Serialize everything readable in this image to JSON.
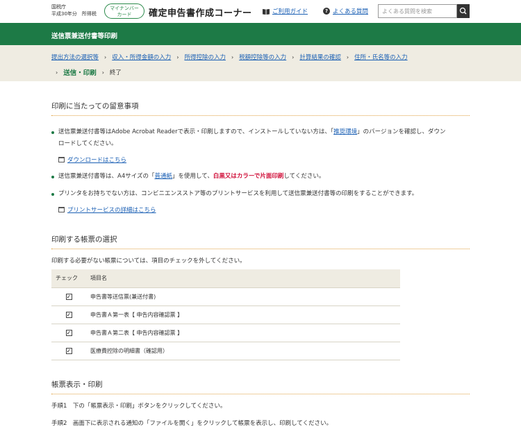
{
  "header": {
    "agency_line1": "国税庁",
    "agency_line2": "平成30年分　所得税",
    "mynumber_line1": "マイナンバー",
    "mynumber_line2": "カード",
    "title": "確定申告書作成コーナー",
    "guide_link": "ご利用ガイド",
    "faq_link": "よくある質問",
    "search_placeholder": "よくある質問を検索"
  },
  "page_heading": "送信票兼送付書等印刷",
  "breadcrumb": {
    "steps": [
      "提出方法の選択等",
      "収入・所得金額の入力",
      "所得控除の入力",
      "税額控除等の入力",
      "計算結果の確認",
      "住所・氏名等の入力"
    ],
    "current": "送信・印刷",
    "last": "終了"
  },
  "notes_section": {
    "heading": "印刷に当たっての留意事項",
    "b1_a": "送信票兼送付書等はAdobe Acrobat Readerで表示・印刷しますので、インストールしていない方は、「",
    "b1_link": "推奨環境",
    "b1_b": "」のバージョンを確認し、ダウン",
    "b1_c": "ロードしてください。",
    "download_link": "ダウンロードはこちら",
    "b2_a": "送信票兼送付書等は、A4サイズの「",
    "b2_link": "普通紙",
    "b2_b": "」を使用して、",
    "b2_red": "白黒又はカラーで片面印刷",
    "b2_c": "してください。",
    "b3": "プリンタをお持ちでない方は、コンビニエンスストア等のプリントサービスを利用して送信票兼送付書等の印刷をすることができます。",
    "print_service_link": "プリントサービスの詳細はこちら"
  },
  "forms_section": {
    "heading": "印刷する帳票の選択",
    "note": "印刷する必要がない帳票については、項目のチェックを外してください。",
    "col_check": "チェック",
    "col_item": "項目名",
    "rows": [
      {
        "name": "申告書等送信票(兼送付書)",
        "checked": "✓"
      },
      {
        "name": "申告書Ａ第一表【 申告内容確認票 】",
        "checked": "✓"
      },
      {
        "name": "申告書Ａ第二表【 申告内容確認票 】",
        "checked": "✓"
      },
      {
        "name": "医療費控除の明細書（確認用）",
        "checked": "✓"
      }
    ]
  },
  "print_section": {
    "heading": "帳票表示・印刷",
    "step1": "手順1　下の「帳票表示・印刷」ボタンをクリックしてください。",
    "step2": "手順2　画面下に表示される通知の「ファイルを開く」をクリックして帳票を表示し、印刷してください。"
  },
  "colors": {
    "brand_green": "#1d7a46",
    "link_blue": "#1a5fb4",
    "accent_red": "#d0103a",
    "beige": "#efece2"
  }
}
